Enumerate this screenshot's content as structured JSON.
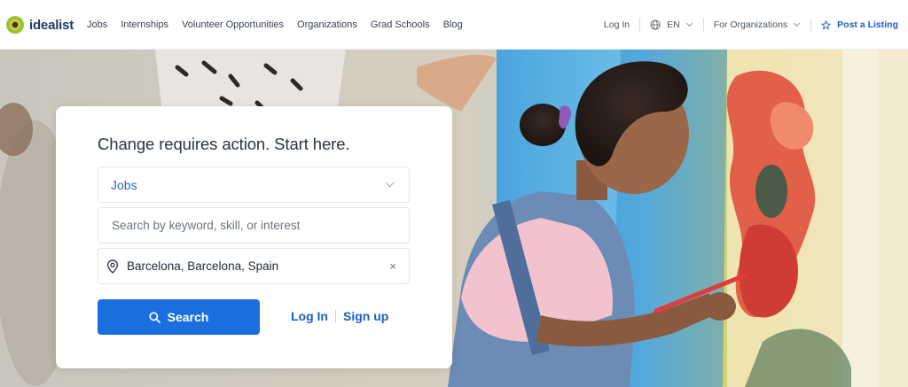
{
  "brand": {
    "name": "idealist",
    "colors": {
      "primary": "#1a6fe0",
      "link": "#1a5fc9",
      "logo_green": "#8cc63f",
      "logo_yellow": "#f7c21a",
      "logo_navy": "#1f3b63"
    }
  },
  "nav": {
    "links": [
      "Jobs",
      "Internships",
      "Volunteer Opportunities",
      "Organizations",
      "Grad Schools",
      "Blog"
    ],
    "login": "Log In",
    "language": "EN",
    "for_orgs": "For Organizations",
    "post_listing": "Post a Listing"
  },
  "search": {
    "title": "Change requires action. Start here.",
    "type_selected": "Jobs",
    "keyword_placeholder": "Search by keyword, skill, or interest",
    "keyword_value": "",
    "location_value": "Barcelona, Barcelona, Spain",
    "clear_glyph": "×",
    "search_label": "Search",
    "login_label": "Log In",
    "signup_label": "Sign up"
  },
  "icons": [
    "idealist-logo-icon",
    "globe-icon",
    "chevron-down-icon",
    "star-icon",
    "location-pin-icon",
    "close-icon",
    "search-icon"
  ]
}
